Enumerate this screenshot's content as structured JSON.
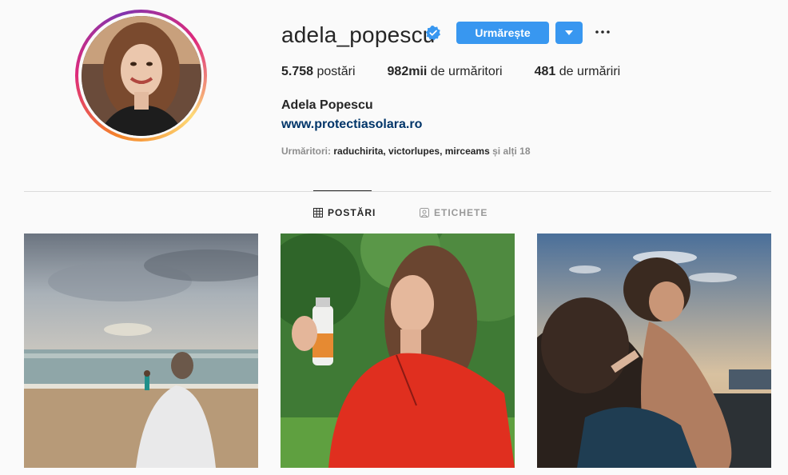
{
  "profile": {
    "username": "adela_popescu",
    "follow_label": "Urmărește",
    "stats": [
      {
        "value": "5.758",
        "label": "postări"
      },
      {
        "value": "982mii",
        "label": "de urmăritori"
      },
      {
        "value": "481",
        "label": "de urmăriri"
      }
    ],
    "full_name": "Adela Popescu",
    "website": "www.protectiasolara.ro",
    "followed_by_prefix": "Urmăritori:",
    "followed_by_names": "raduchirita, victorlupes, mirceams",
    "followed_by_suffix": "și alți 18"
  },
  "tabs": [
    {
      "label": "POSTĂRI",
      "icon": "grid-icon",
      "active": true
    },
    {
      "label": "ETICHETE",
      "icon": "tag-person-icon",
      "active": false
    }
  ],
  "colors": {
    "accent": "#3897f0",
    "link": "#003569",
    "muted": "#8e8e8e",
    "divider": "#dbdbdb"
  },
  "icons": {
    "verified": "verified-badge-icon",
    "dropdown": "chevron-down-icon",
    "more": "more-dots-icon"
  },
  "posts": [
    {
      "subject": "beach-cloudy-sea"
    },
    {
      "subject": "woman-red-shirt-sunscreen"
    },
    {
      "subject": "mother-child-sunset"
    }
  ]
}
